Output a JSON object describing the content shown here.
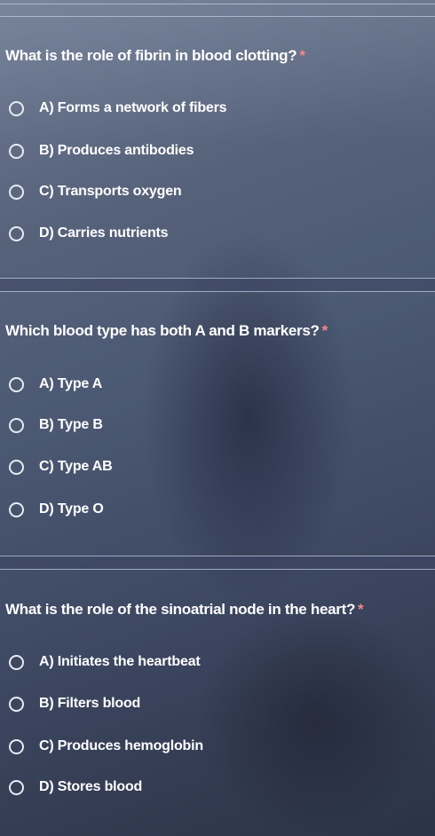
{
  "form": {
    "questions": [
      {
        "text": "What is the role of fibrin in blood clotting?",
        "required_mark": "*",
        "options": [
          "A) Forms a network of fibers",
          "B) Produces antibodies",
          "C) Transports oxygen",
          "D) Carries nutrients"
        ]
      },
      {
        "text": "Which blood type has both A and B markers?",
        "required_mark": "*",
        "options": [
          "A) Type A",
          "B) Type B",
          "C) Type AB",
          "D) Type O"
        ]
      },
      {
        "text": "What is the role of the sinoatrial node in the heart?",
        "required_mark": "*",
        "options": [
          "A) Initiates the heartbeat",
          "B) Filters blood",
          "C) Produces hemoglobin",
          "D) Stores blood"
        ]
      }
    ]
  },
  "colors": {
    "required_asterisk": "#f08a8a",
    "radio_border": "#e6ebf2",
    "text": "#ffffff"
  }
}
